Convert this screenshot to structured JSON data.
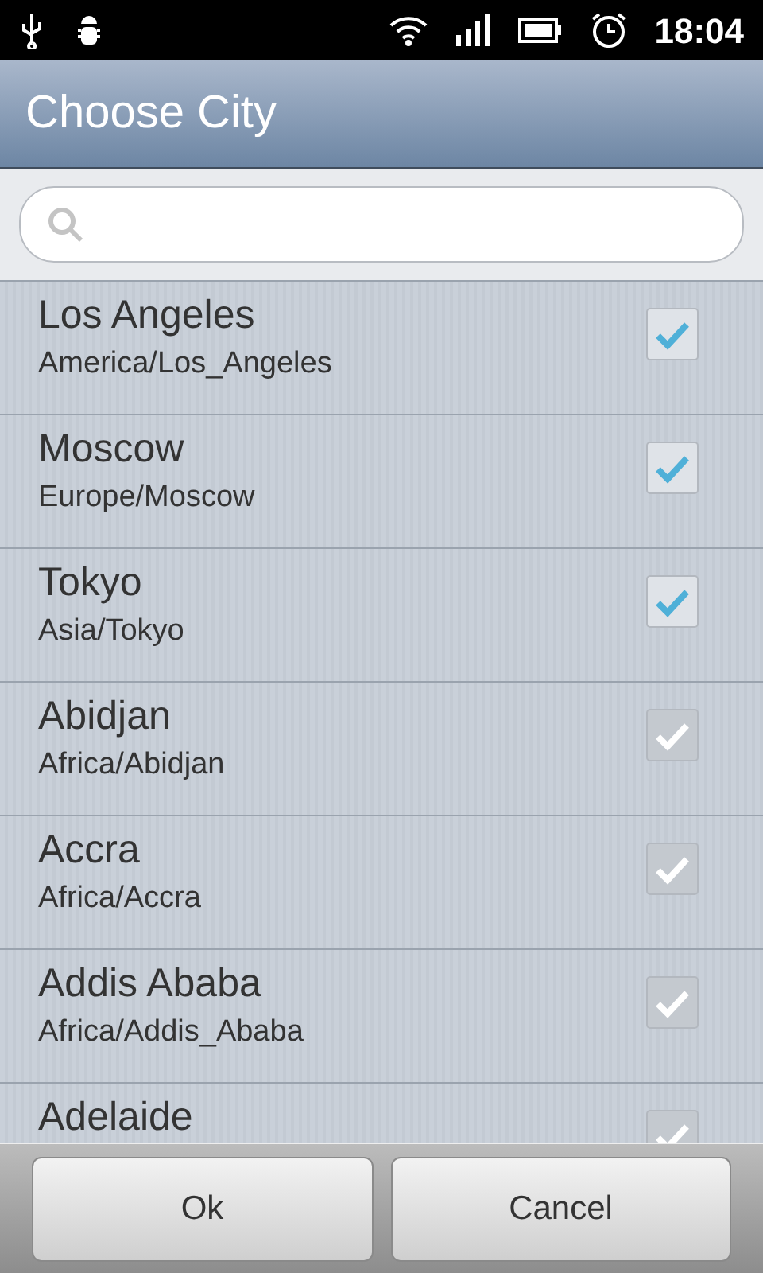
{
  "status_bar": {
    "time": "18:04"
  },
  "window": {
    "title": "Choose City"
  },
  "cities": [
    {
      "name": "Los Angeles",
      "zone": "America/Los_Angeles",
      "checked": true
    },
    {
      "name": "Moscow",
      "zone": "Europe/Moscow",
      "checked": true
    },
    {
      "name": "Tokyo",
      "zone": "Asia/Tokyo",
      "checked": true
    },
    {
      "name": "Abidjan",
      "zone": "Africa/Abidjan",
      "checked": false
    },
    {
      "name": "Accra",
      "zone": "Africa/Accra",
      "checked": false
    },
    {
      "name": "Addis Ababa",
      "zone": "Africa/Addis_Ababa",
      "checked": false
    },
    {
      "name": "Adelaide",
      "checked": false
    }
  ],
  "buttons": [
    {
      "label": "Ok"
    },
    {
      "label": "Cancel"
    }
  ]
}
